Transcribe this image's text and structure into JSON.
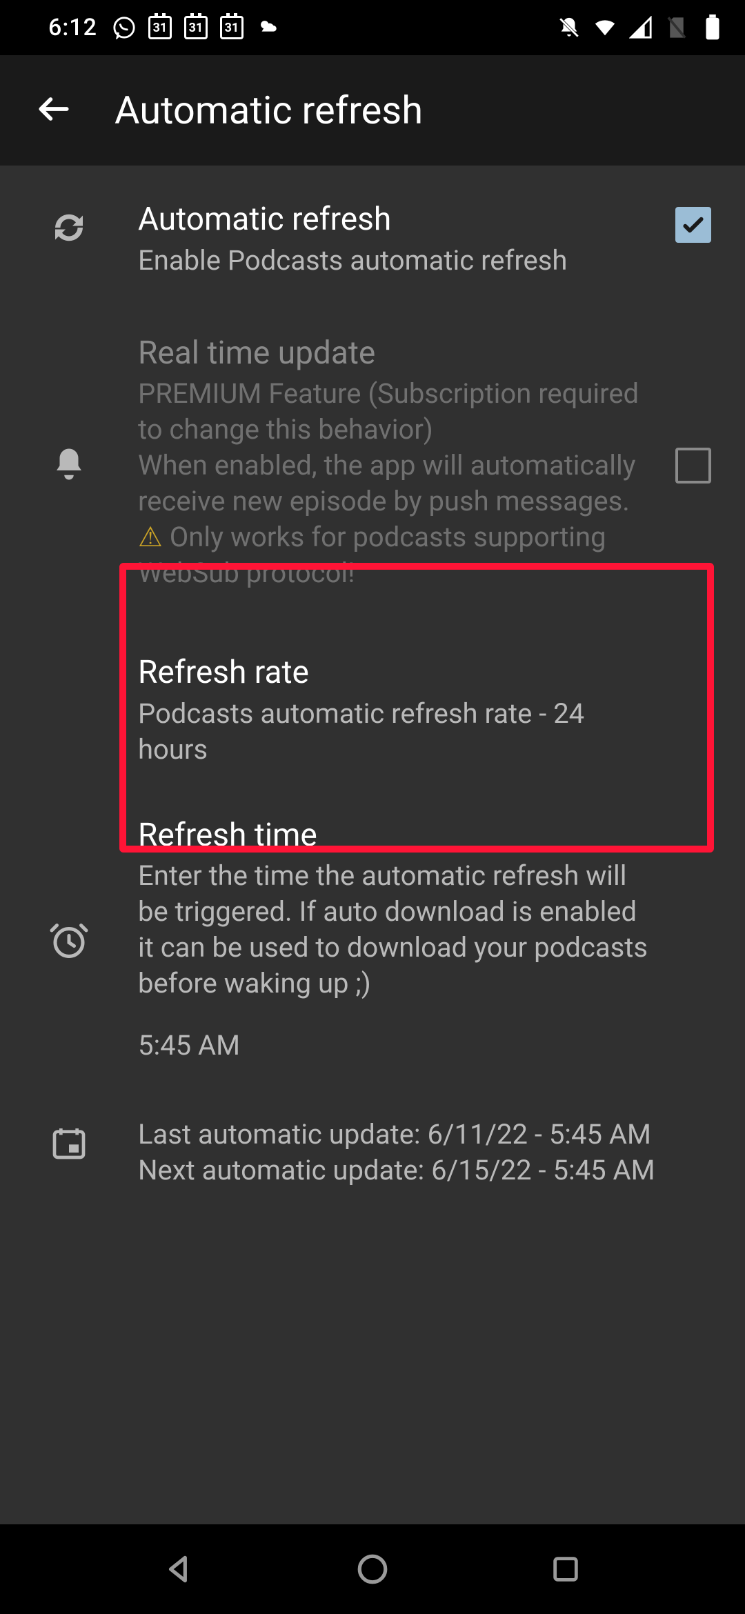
{
  "status": {
    "time": "6:12",
    "calendar_day": "31"
  },
  "appbar": {
    "title": "Automatic refresh"
  },
  "settings": {
    "auto_refresh": {
      "title": "Automatic refresh",
      "subtitle": "Enable Podcasts automatic refresh",
      "checked": true
    },
    "real_time": {
      "title": "Real time update",
      "subtitle_line1": "PREMIUM Feature (Subscription required to change this behavior)",
      "subtitle_line2": "When enabled, the app will automatically receive new episode by push messages.",
      "warn_text": "Only works for podcasts supporting WebSub protocol!",
      "checked": false
    },
    "refresh_rate": {
      "title": "Refresh rate",
      "subtitle": "Podcasts automatic refresh rate - 24 hours"
    },
    "refresh_time": {
      "title": "Refresh time",
      "subtitle": "Enter the time the automatic refresh will be triggered. If auto download is enabled it can be used to download your podcasts before waking up ;)",
      "value": "5:45 AM"
    },
    "schedule": {
      "last": "Last automatic update: 6/11/22 - 5:45 AM",
      "next": "Next automatic update: 6/15/22 - 5:45 AM"
    }
  }
}
